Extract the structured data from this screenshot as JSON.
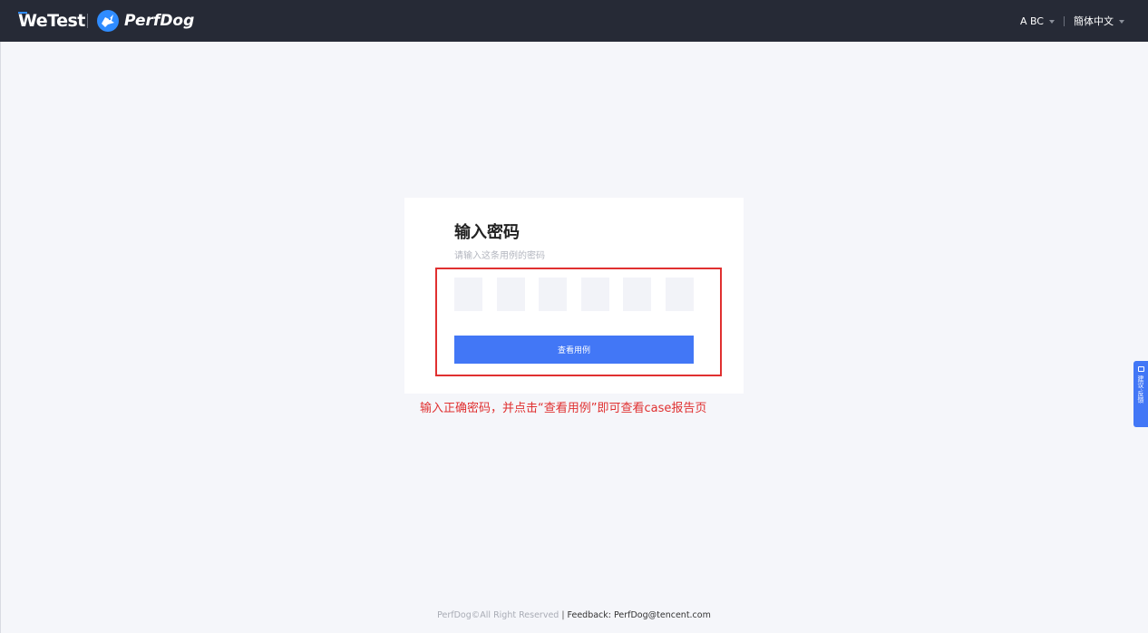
{
  "header": {
    "brand_wetest": "WeTest",
    "brand_perfdog": "PerfDog",
    "user_label": "A BC",
    "language_label": "簡体中文"
  },
  "card": {
    "title": "输入密码",
    "subtitle": "请输入这条用例的密码",
    "code_boxes": [
      "",
      "",
      "",
      "",
      "",
      ""
    ],
    "submit_label": "查看用例"
  },
  "annotation": {
    "text": "输入正确密码，并点击“查看用例”即可查看case报告页"
  },
  "side_tab": {
    "label": "建议·反馈"
  },
  "footer": {
    "copyright": "PerfDog©All Right Reserved",
    "separator": "|",
    "feedback": "Feedback: PerfDog@tencent.com"
  },
  "colors": {
    "topbar_bg": "#262a36",
    "accent": "#4277f6",
    "annotation_red": "#e03030",
    "page_bg": "#f5f6fa"
  }
}
